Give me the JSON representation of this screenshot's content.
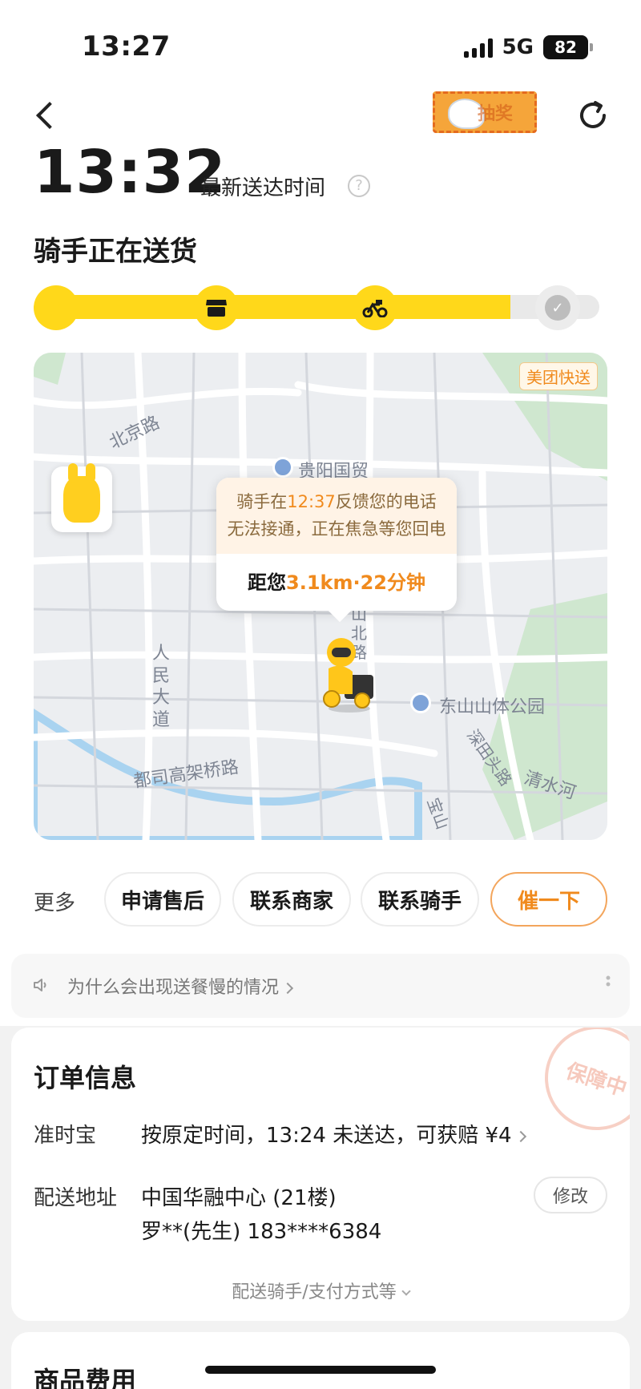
{
  "status_bar": {
    "time": "13:27",
    "network": "5G",
    "battery": "82"
  },
  "header": {
    "lottery_label": "抽奖"
  },
  "eta": {
    "time": "13:32",
    "label": "最新送达时间",
    "help": "?"
  },
  "order_status": {
    "title": "骑手正在送货",
    "progress": 0.84
  },
  "progress_steps": [
    {
      "icon": "yen-icon",
      "glyph": "¥",
      "state": "done"
    },
    {
      "icon": "store-icon",
      "glyph": "▀",
      "state": "done"
    },
    {
      "icon": "rider-icon",
      "glyph": "⛟",
      "state": "current"
    },
    {
      "icon": "check-icon",
      "glyph": "✓",
      "state": "pending"
    }
  ],
  "map": {
    "brand": "美团快送",
    "labels": {
      "beijing_road": "北京路",
      "guiyang_trade": "贵阳国贸",
      "renmin_ave": "人民大道",
      "dusi_elevated": "都司高架桥路",
      "dongshan_park": "东山山体公园",
      "qingshui_river": "清水河",
      "shanbei_road": "山北路",
      "xiantian_road": "深田头路",
      "baoshan": "宝山"
    },
    "rider_notice_prefix": "骑手在",
    "rider_notice_time": "12:37",
    "rider_notice_mid": "反馈您的电话",
    "rider_notice_line2": "无法接通，正在焦急等您回电",
    "distance_prefix": "距您",
    "distance_value": "3.1km·22分钟"
  },
  "actions": {
    "more": "更多",
    "after_sale": "申请售后",
    "contact_merchant": "联系商家",
    "contact_rider": "联系骑手",
    "urge": "催一下"
  },
  "tip": {
    "text": "为什么会出现送餐慢的情况"
  },
  "order_info": {
    "title": "订单信息",
    "stamp": "保障中",
    "ontime_label": "准时宝",
    "ontime_value": "按原定时间，13:24 未送达，可获赔 ¥4",
    "address_label": "配送地址",
    "address_line1": "中国华融中心 (21楼)",
    "address_line2": "罗**(先生) 183****6384",
    "edit": "修改",
    "expand": "配送骑手/支付方式等"
  },
  "fees": {
    "title": "商品费用"
  },
  "colors": {
    "accent": "#ffd81a",
    "orange": "#f08a1d"
  }
}
